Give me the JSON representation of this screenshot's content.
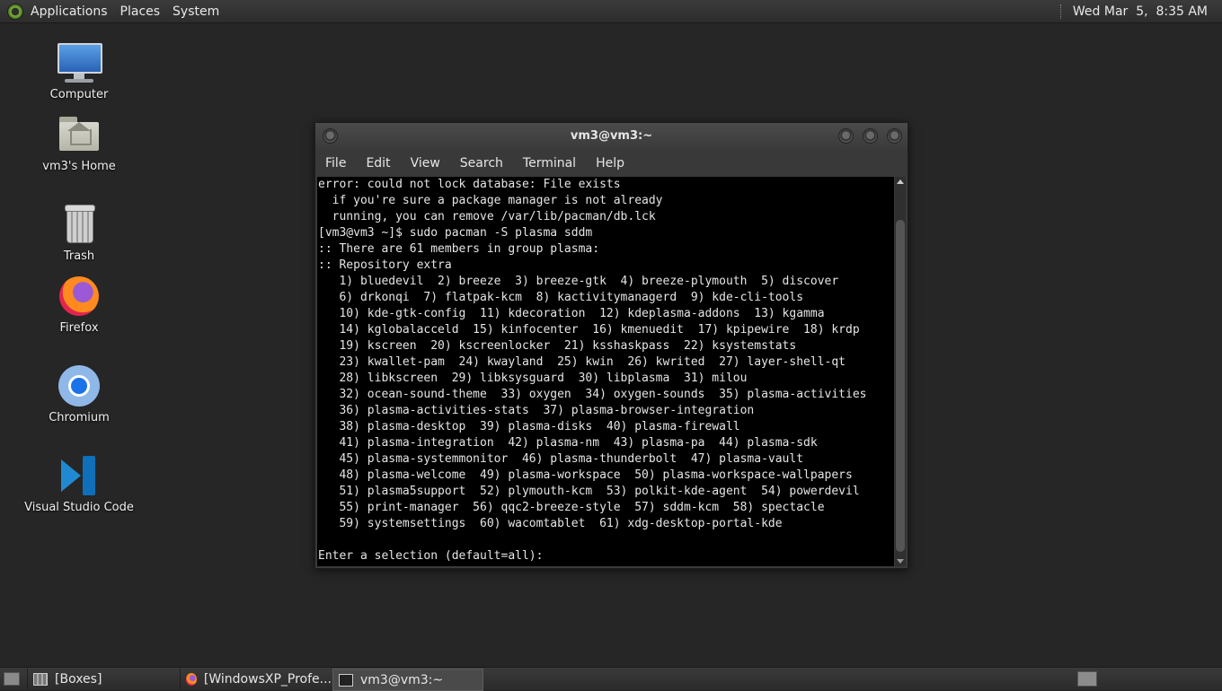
{
  "top_panel": {
    "menus": [
      "Applications",
      "Places",
      "System"
    ],
    "clock": "Wed Mar  5,  8:35 AM"
  },
  "desktop_icons": [
    {
      "label": "Computer",
      "icon": "computer-icon"
    },
    {
      "label": "vm3's Home",
      "icon": "home-folder-icon"
    },
    {
      "label": "Trash",
      "icon": "trash-icon"
    },
    {
      "label": "Firefox",
      "icon": "firefox-icon"
    },
    {
      "label": "Chromium",
      "icon": "chromium-icon"
    },
    {
      "label": "Visual Studio Code",
      "icon": "vscode-icon"
    }
  ],
  "window": {
    "title": "vm3@vm3:~",
    "menu": [
      "File",
      "Edit",
      "View",
      "Search",
      "Terminal",
      "Help"
    ]
  },
  "terminal_lines": [
    "error: could not lock database: File exists",
    "  if you're sure a package manager is not already",
    "  running, you can remove /var/lib/pacman/db.lck",
    "[vm3@vm3 ~]$ sudo pacman -S plasma sddm",
    ":: There are 61 members in group plasma:",
    ":: Repository extra",
    "   1) bluedevil  2) breeze  3) breeze-gtk  4) breeze-plymouth  5) discover",
    "   6) drkonqi  7) flatpak-kcm  8) kactivitymanagerd  9) kde-cli-tools",
    "   10) kde-gtk-config  11) kdecoration  12) kdeplasma-addons  13) kgamma",
    "   14) kglobalacceld  15) kinfocenter  16) kmenuedit  17) kpipewire  18) krdp",
    "   19) kscreen  20) kscreenlocker  21) ksshaskpass  22) ksystemstats",
    "   23) kwallet-pam  24) kwayland  25) kwin  26) kwrited  27) layer-shell-qt",
    "   28) libkscreen  29) libksysguard  30) libplasma  31) milou",
    "   32) ocean-sound-theme  33) oxygen  34) oxygen-sounds  35) plasma-activities",
    "   36) plasma-activities-stats  37) plasma-browser-integration",
    "   38) plasma-desktop  39) plasma-disks  40) plasma-firewall",
    "   41) plasma-integration  42) plasma-nm  43) plasma-pa  44) plasma-sdk",
    "   45) plasma-systemmonitor  46) plasma-thunderbolt  47) plasma-vault",
    "   48) plasma-welcome  49) plasma-workspace  50) plasma-workspace-wallpapers",
    "   51) plasma5support  52) plymouth-kcm  53) polkit-kde-agent  54) powerdevil",
    "   55) print-manager  56) qqc2-breeze-style  57) sddm-kcm  58) spectacle",
    "   59) systemsettings  60) wacomtablet  61) xdg-desktop-portal-kde",
    "",
    "Enter a selection (default=all): "
  ],
  "taskbar": {
    "tasks": [
      {
        "label": "[Boxes]",
        "icon": "boxes-icon"
      },
      {
        "label": "[WindowsXP_Profe...",
        "icon": "firefox-icon"
      },
      {
        "label": "vm3@vm3:~",
        "icon": "terminal-icon"
      }
    ]
  }
}
